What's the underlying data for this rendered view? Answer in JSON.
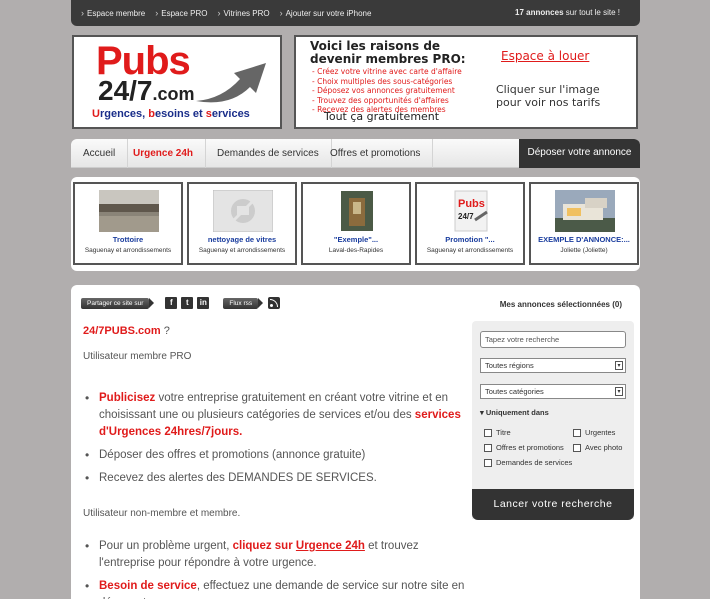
{
  "topbar": {
    "links": [
      "Espace membre",
      "Espace PRO",
      "Vitrines PRO",
      "Ajouter sur votre iPhone"
    ],
    "count_bold": "17 annonces",
    "count_rest": "sur tout le site !"
  },
  "logo": {
    "pubs": "Pubs",
    "number": "24/7",
    "com": ".com",
    "sub_u": "U",
    "sub_1": "rgences, ",
    "sub_b": "b",
    "sub_2": "esoins et ",
    "sub_s": "s",
    "sub_3": "ervices"
  },
  "promo": {
    "title": "Voici les raisons de devenir membres PRO:",
    "bullets": [
      "- Créez votre vitrine avec carte d'affaire",
      "- Choix multiples des sous-catégories",
      "- Déposez vos annonces gratuitement",
      "- Trouvez des opportunités d'affaires",
      "- Recevez des alertes des membres"
    ],
    "free": "Tout  ça gratuitement",
    "espace": "Espace à louer",
    "click_1": "Cliquer sur l'image",
    "click_2": "pour voir nos tarifs"
  },
  "nav": {
    "items": [
      "Accueil",
      "Urgence 24h",
      "Demandes de services",
      "Offres et promotions"
    ],
    "cta": "Déposer votre annonce"
  },
  "listings": [
    {
      "title": "Trottoire",
      "location": "Saguenay et arrondissements"
    },
    {
      "title": "nettoyage de vitres",
      "location": "Saguenay et arrondissements"
    },
    {
      "title": "\"Exemple\"...",
      "location": "Laval-des-Rapides"
    },
    {
      "title": "Promotion \"...",
      "location": "Saguenay et arrondissements"
    },
    {
      "title": "EXEMPLE D'ANNONCE:...",
      "location": "Joliette (Joliette)"
    }
  ],
  "share": {
    "share_label": "Partager ce site sur",
    "fb": "f",
    "tw": "t",
    "li": "in",
    "rss_label": "Flux rss"
  },
  "selected": "Mes annonces sélectionnées (0)",
  "content": {
    "heading": "24/7PUBS.com",
    "heading_q": " ?",
    "pro_label": "Utilisateur membre PRO",
    "b1_red": "Publicisez",
    "b1_text": " votre entreprise  gratuitement en créant votre vitrine et en choisissant une ou plusieurs catégories de services et/ou des ",
    "b1_red2": "services d'Urgences 24hres/7jours.",
    "b2": "Déposer des offres et promotions (annonce gratuite)",
    "b3": "Recevez des alertes des DEMANDES DE SERVICES.",
    "nonmember_label": "Utilisateur non-membre et membre.",
    "b4_a": "Pour un problème urgent, ",
    "b4_red": "cliquez sur ",
    "b4_link": "Urgence 24h",
    "b4_b": " et trouvez l'entreprise  pour répondre à votre urgence.",
    "b5_red": "Besoin de service",
    "b5_text": ", effectuez une demande de service sur notre site en déposant une annonce"
  },
  "search": {
    "placeholder": "Tapez votre recherche",
    "regions": "Toutes régions",
    "categories": "Toutes catégories",
    "uniquement": "Uniquement dans",
    "opt_titre": "Titre",
    "opt_urgentes": "Urgentes",
    "opt_offres": "Offres et promotions",
    "opt_photo": "Avec photo",
    "opt_demandes": "Demandes de services",
    "button": "Lancer votre recherche"
  }
}
